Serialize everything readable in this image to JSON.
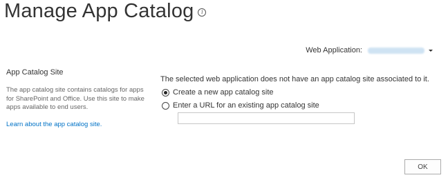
{
  "header": {
    "title": "Manage App Catalog",
    "info_icon": "info-icon"
  },
  "web_application": {
    "label": "Web Application:",
    "value_obscured": true
  },
  "section": {
    "title": "App Catalog Site",
    "description": "The app catalog site contains catalogs for apps for SharePoint and Office. Use this site to make apps available to end users.",
    "learn_link": "Learn about the app catalog site."
  },
  "main": {
    "notice": "The selected web application does not have an app catalog site associated to it.",
    "options": [
      {
        "label": "Create a new app catalog site",
        "selected": true
      },
      {
        "label": "Enter a URL for an existing app catalog site",
        "selected": false
      }
    ],
    "url_value": ""
  },
  "footer": {
    "ok_label": "OK"
  }
}
